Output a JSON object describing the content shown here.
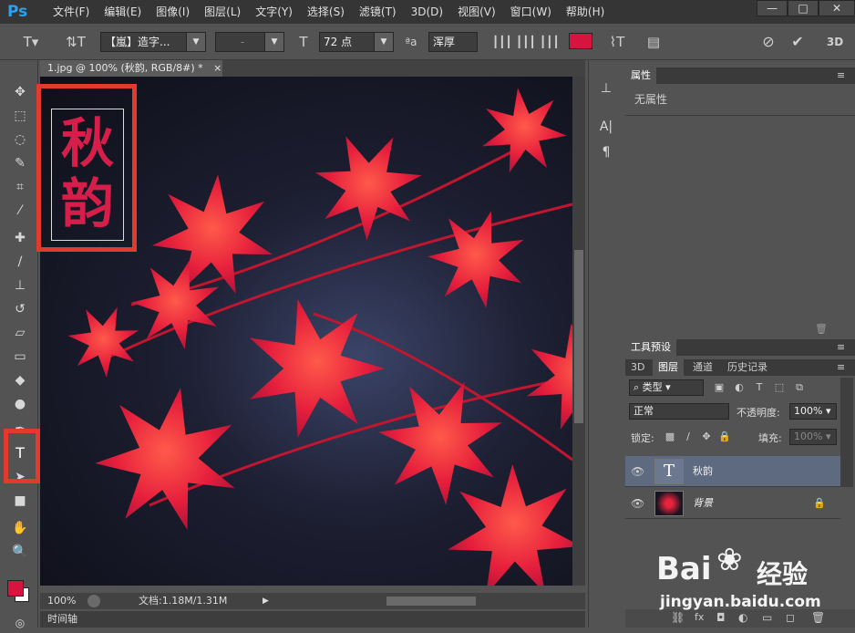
{
  "app": {
    "logo": "Ps"
  },
  "menu": [
    "文件(F)",
    "编辑(E)",
    "图像(I)",
    "图层(L)",
    "文字(Y)",
    "选择(S)",
    "滤镜(T)",
    "3D(D)",
    "视图(V)",
    "窗口(W)",
    "帮助(H)"
  ],
  "window_controls": {
    "minimize": "—",
    "maximize": "□",
    "close": "✕"
  },
  "options": {
    "font_family": "【嵐】造字...",
    "font_style": "-",
    "font_size": "72 点",
    "antialias_label": "ªa",
    "antialias": "浑厚",
    "text_color": "#d6143f",
    "mode_3d": "3D"
  },
  "document": {
    "tab_title": "1.jpg @ 100% (秋韵, RGB/8#) *",
    "tab_close": "×",
    "text": "秋韵",
    "text_color": "#d61e4b",
    "zoom": "100%",
    "doc_info": "文档:1.18M/1.31M"
  },
  "timeline": {
    "label": "时间轴"
  },
  "colors": {
    "foreground": "#d6143f",
    "background": "#ffffff",
    "highlight": "#e23b2d",
    "leaf": "#e8243c"
  },
  "properties": {
    "tab": "属性",
    "content": "无属性"
  },
  "tool_presets": {
    "tab": "工具预设"
  },
  "layers_panel": {
    "tabs": [
      "3D",
      "图层",
      "通道",
      "历史记录"
    ],
    "filter_kind": "类型",
    "blend_mode": "正常",
    "opacity_label": "不透明度:",
    "opacity": "100%",
    "lock_label": "锁定:",
    "fill_label": "填充:",
    "fill": "100%",
    "layers": [
      {
        "name": "秋韵",
        "type": "text",
        "thumb_label": "T"
      },
      {
        "name": "背景",
        "type": "image"
      }
    ]
  },
  "watermark": {
    "brand": "Bai",
    "brand_suffix": "经验",
    "url": "jingyan.baidu.com"
  }
}
